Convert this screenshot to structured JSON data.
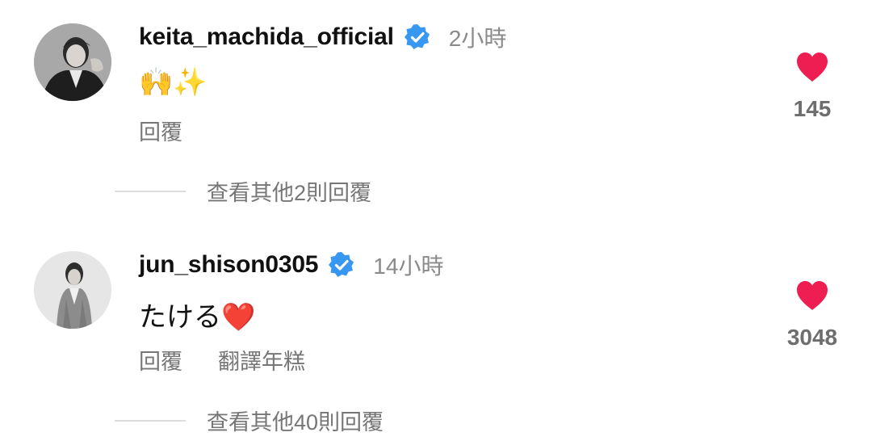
{
  "comments": [
    {
      "username": "keita_machida_official",
      "time": "2小時",
      "text": "🙌✨",
      "actions": [
        "回覆"
      ],
      "likes": "145",
      "view_replies": "查看其他2則回覆"
    },
    {
      "username": "jun_shison0305",
      "time": "14小時",
      "text": "たける❤️",
      "actions": [
        "回覆",
        "翻譯年糕"
      ],
      "likes": "3048",
      "view_replies": "查看其他40則回覆"
    }
  ],
  "colors": {
    "verified_badge": "#3897f0",
    "like_heart": "#ee1d52",
    "secondary_text": "#767676"
  }
}
